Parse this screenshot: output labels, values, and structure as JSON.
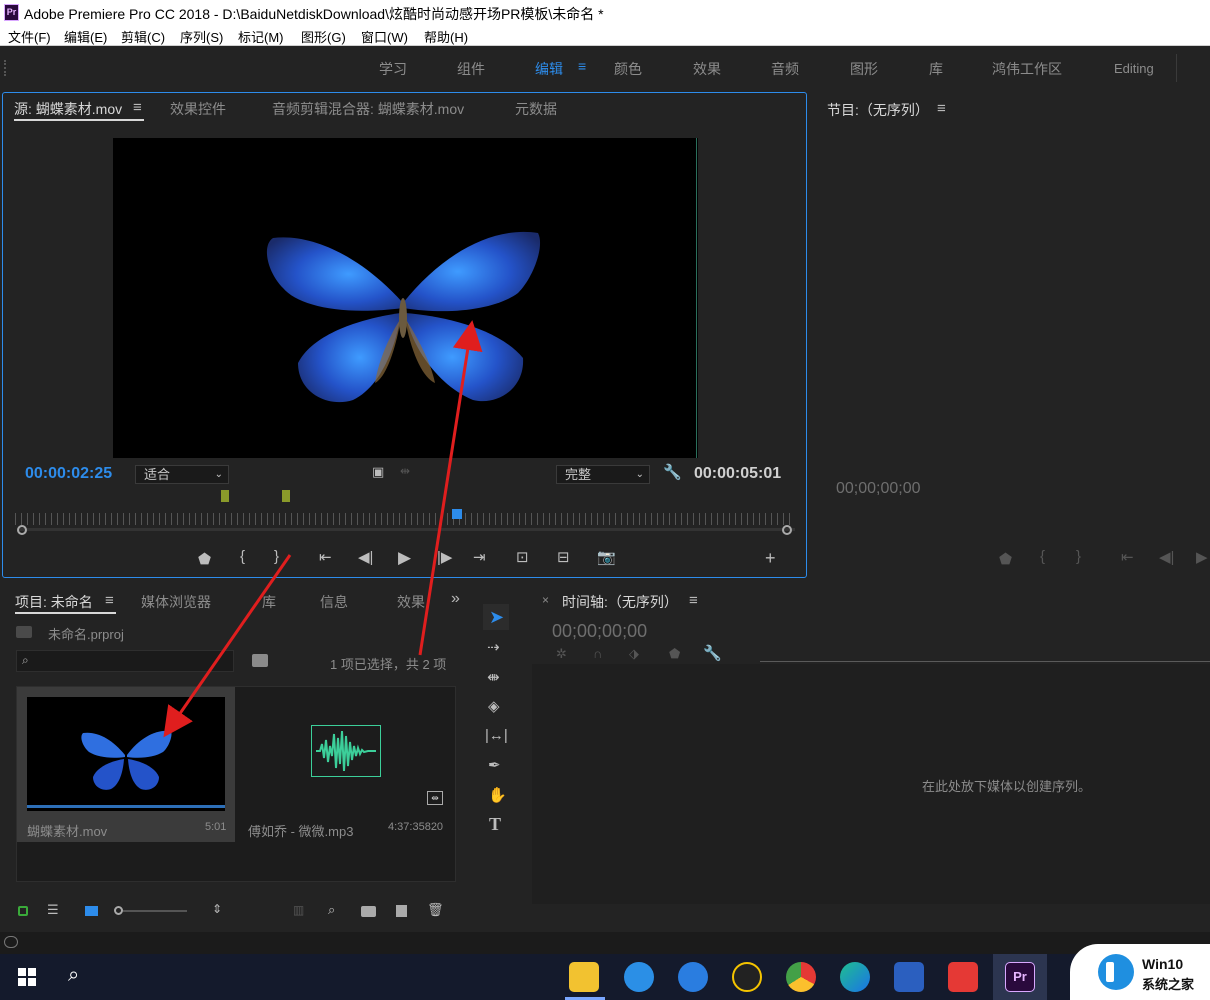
{
  "titlebar": {
    "app_badge": "Pr",
    "title": "Adobe Premiere Pro CC 2018 - D:\\BaiduNetdiskDownload\\炫酷时尚动感开场PR模板\\未命名 *"
  },
  "menu": [
    "文件(F)",
    "编辑(E)",
    "剪辑(C)",
    "序列(S)",
    "标记(M)",
    "图形(G)",
    "窗口(W)",
    "帮助(H)"
  ],
  "workspaces": {
    "tabs": [
      "学习",
      "组件",
      "编辑",
      "颜色",
      "效果",
      "音频",
      "图形",
      "库",
      "鸿伟工作区",
      "Editing"
    ],
    "active": "编辑"
  },
  "source_panel": {
    "tabs": [
      "源: 蝴蝶素材.mov",
      "效果控件",
      "音频剪辑混合器: 蝴蝶素材.mov",
      "元数据"
    ],
    "menu_glyph": "≡",
    "current_time": "00:00:02:25",
    "fit_label": "适合",
    "quality_label": "完整",
    "duration": "00:00:05:01",
    "playhead_fraction": 0.56
  },
  "program_panel": {
    "tab": "节目:（无序列）",
    "menu_glyph": "≡",
    "timecode": "00;00;00;00"
  },
  "project_panel": {
    "tabs": [
      "项目: 未命名",
      "媒体浏览器",
      "库",
      "信息",
      "效果"
    ],
    "overflow": "»",
    "project_file": "未命名.prproj",
    "selection_status": "1 项已选择，共 2 项",
    "items": [
      {
        "name": "蝴蝶素材.mov",
        "duration": "5:01",
        "type": "video"
      },
      {
        "name": "傅如乔 - 微微.mp3",
        "duration": "4:37:35820",
        "type": "audio"
      }
    ]
  },
  "timeline_panel": {
    "close": "×",
    "tab": "时间轴:（无序列）",
    "menu_glyph": "≡",
    "timecode": "00;00;00;00",
    "empty_message": "在此处放下媒体以创建序列。"
  },
  "colors": {
    "accent": "#2d8ceb",
    "panel_bg": "#232323",
    "arrow": "#e01e1e",
    "audio_wave": "#3ccf9a"
  },
  "watermark": {
    "brand": "Win10",
    "subtitle": "系统之家"
  }
}
